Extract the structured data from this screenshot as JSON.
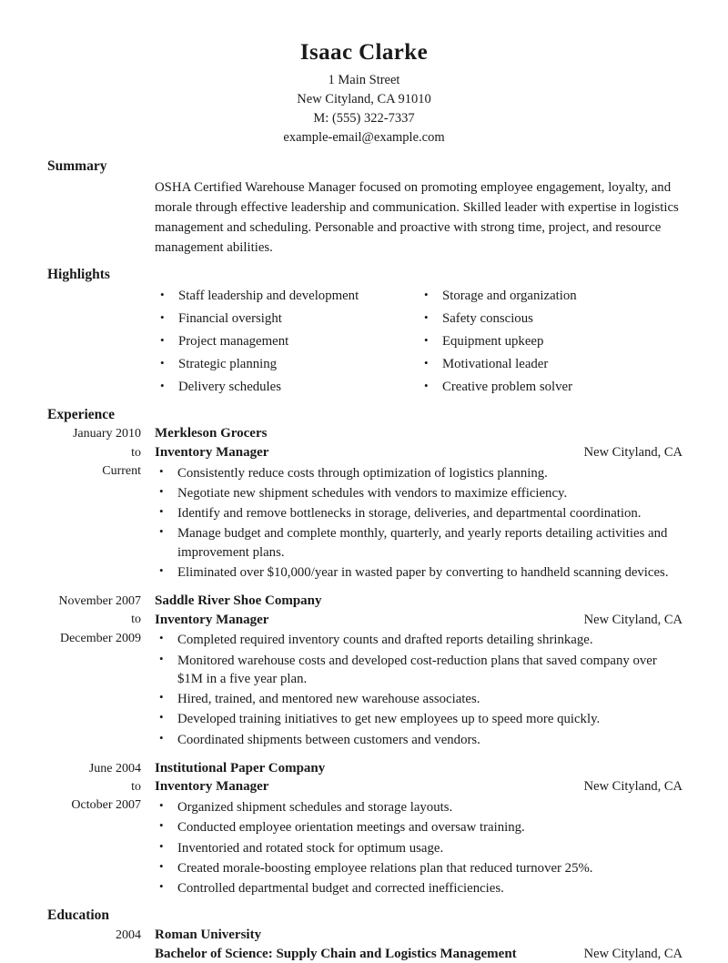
{
  "header": {
    "name": "Isaac Clarke",
    "address": "1 Main Street",
    "city_state_zip": "New Cityland, CA 91010",
    "phone": "M: (555) 322-7337",
    "email": "example-email@example.com"
  },
  "sections": {
    "summary": {
      "heading": "Summary",
      "body": "OSHA Certified Warehouse Manager focused on promoting employee engagement, loyalty, and morale through effective leadership and communication. Skilled leader with expertise in logistics management and scheduling. Personable and proactive with strong time, project, and resource management abilities."
    },
    "highlights": {
      "heading": "Highlights",
      "column_left": [
        "Staff leadership and development",
        "Financial oversight",
        "Project management",
        "Strategic planning",
        "Delivery schedules"
      ],
      "column_right": [
        "Storage and organization",
        "Safety conscious",
        "Equipment upkeep",
        "Motivational leader",
        "Creative problem solver"
      ]
    },
    "experience": {
      "heading": "Experience",
      "entries": [
        {
          "date_start": "January 2010",
          "date_separator": "to",
          "date_end": "Current",
          "organization": "Merkleson Grocers",
          "title": "Inventory Manager",
          "location": "New Cityland, CA",
          "bullets": [
            "Consistently reduce costs through optimization of logistics planning.",
            "Negotiate new shipment schedules with vendors to maximize efficiency.",
            "Identify and remove bottlenecks in storage, deliveries, and departmental coordination.",
            "Manage budget and complete monthly, quarterly, and yearly reports detailing activities and improvement plans.",
            "Eliminated over $10,000/year in wasted paper by converting to handheld scanning devices."
          ]
        },
        {
          "date_start": "November 2007",
          "date_separator": "to",
          "date_end": "December 2009",
          "organization": "Saddle River Shoe Company",
          "title": "Inventory Manager",
          "location": "New Cityland, CA",
          "bullets": [
            "Completed required inventory counts and drafted reports detailing shrinkage.",
            "Monitored warehouse costs and developed cost-reduction plans that saved company over $1M in a five year plan.",
            "Hired, trained, and mentored new warehouse associates.",
            "Developed training initiatives to get new employees up to speed more quickly.",
            "Coordinated shipments between customers and vendors."
          ]
        },
        {
          "date_start": "June 2004",
          "date_separator": "to",
          "date_end": "October 2007",
          "organization": "Institutional Paper Company",
          "title": "Inventory Manager",
          "location": "New Cityland, CA",
          "bullets": [
            "Organized shipment schedules and storage layouts.",
            "Conducted employee orientation meetings and oversaw training.",
            "Inventoried and rotated stock for optimum usage.",
            "Created morale-boosting employee relations plan that reduced turnover 25%.",
            "Controlled departmental budget and corrected inefficiencies."
          ]
        }
      ]
    },
    "education": {
      "heading": "Education",
      "entries": [
        {
          "date": "2004",
          "school": "Roman University",
          "degree": "Bachelor of Science: Supply Chain and Logistics Management",
          "location": "New Cityland, CA"
        }
      ]
    }
  }
}
